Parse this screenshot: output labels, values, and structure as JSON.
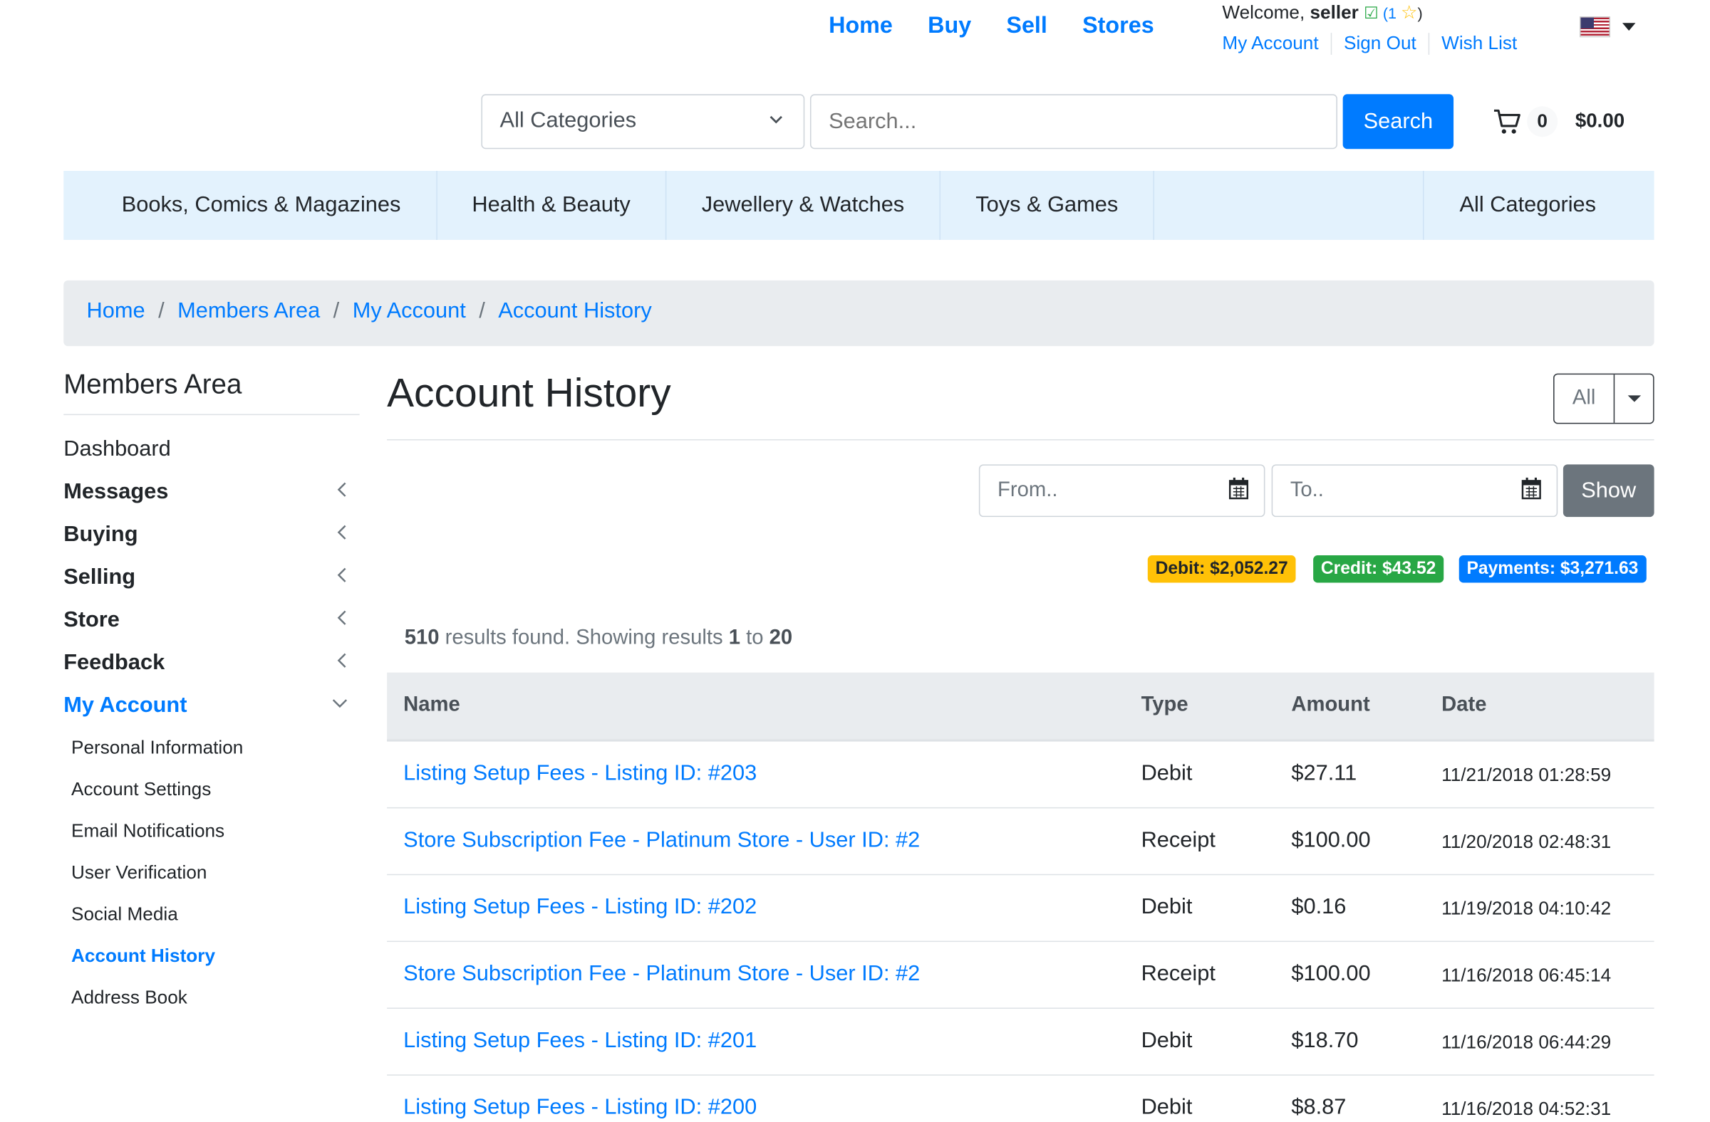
{
  "top_nav": [
    "Home",
    "Buy",
    "Sell",
    "Stores"
  ],
  "user": {
    "welcome_prefix": "Welcome, ",
    "username": "seller",
    "feedback_open": " (1 ",
    "feedback_close": ")",
    "links": [
      "My Account",
      "Sign Out",
      "Wish List"
    ]
  },
  "search": {
    "category": "All Categories",
    "placeholder": "Search...",
    "button": "Search"
  },
  "cart": {
    "count": "0",
    "total": "$0.00"
  },
  "category_bar": [
    "Books, Comics & Magazines",
    "Health & Beauty",
    "Jewellery & Watches",
    "Toys & Games",
    "All Categories"
  ],
  "breadcrumb": [
    "Home",
    "Members Area",
    "My Account",
    "Account History"
  ],
  "sidebar": {
    "title": "Members Area",
    "items": [
      "Dashboard",
      "Messages",
      "Buying",
      "Selling",
      "Store",
      "Feedback",
      "My Account"
    ],
    "sub_items": [
      "Personal Information",
      "Account Settings",
      "Email Notifications",
      "User Verification",
      "Social Media",
      "Account History",
      "Address Book"
    ]
  },
  "main": {
    "title": "Account History",
    "filter": "All",
    "from_placeholder": "From..",
    "to_placeholder": "To..",
    "show_button": "Show",
    "badges": {
      "debit": "Debit: $2,052.27",
      "credit": "Credit: $43.52",
      "payments": "Payments: $3,271.63"
    },
    "results": {
      "total": "510",
      "text_mid": " results found. Showing results ",
      "from": "1",
      "text_to": " to ",
      "to": "20"
    },
    "colors": {
      "debit": "#ffc107",
      "credit": "#28a745",
      "payments": "#007bff"
    }
  },
  "table": {
    "headers": [
      "Name",
      "Type",
      "Amount",
      "Date"
    ],
    "rows": [
      {
        "name": "Listing Setup Fees - Listing ID: #203",
        "type": "Debit",
        "amount": "$27.11",
        "date": "11/21/2018 01:28:59"
      },
      {
        "name": "Store Subscription Fee - Platinum Store - User ID: #2",
        "type": "Receipt",
        "amount": "$100.00",
        "date": "11/20/2018 02:48:31"
      },
      {
        "name": "Listing Setup Fees - Listing ID: #202",
        "type": "Debit",
        "amount": "$0.16",
        "date": "11/19/2018 04:10:42"
      },
      {
        "name": "Store Subscription Fee - Platinum Store - User ID: #2",
        "type": "Receipt",
        "amount": "$100.00",
        "date": "11/16/2018 06:45:14"
      },
      {
        "name": "Listing Setup Fees - Listing ID: #201",
        "type": "Debit",
        "amount": "$18.70",
        "date": "11/16/2018 06:44:29"
      },
      {
        "name": "Listing Setup Fees - Listing ID: #200",
        "type": "Debit",
        "amount": "$8.87",
        "date": "11/16/2018 04:52:31"
      }
    ]
  }
}
